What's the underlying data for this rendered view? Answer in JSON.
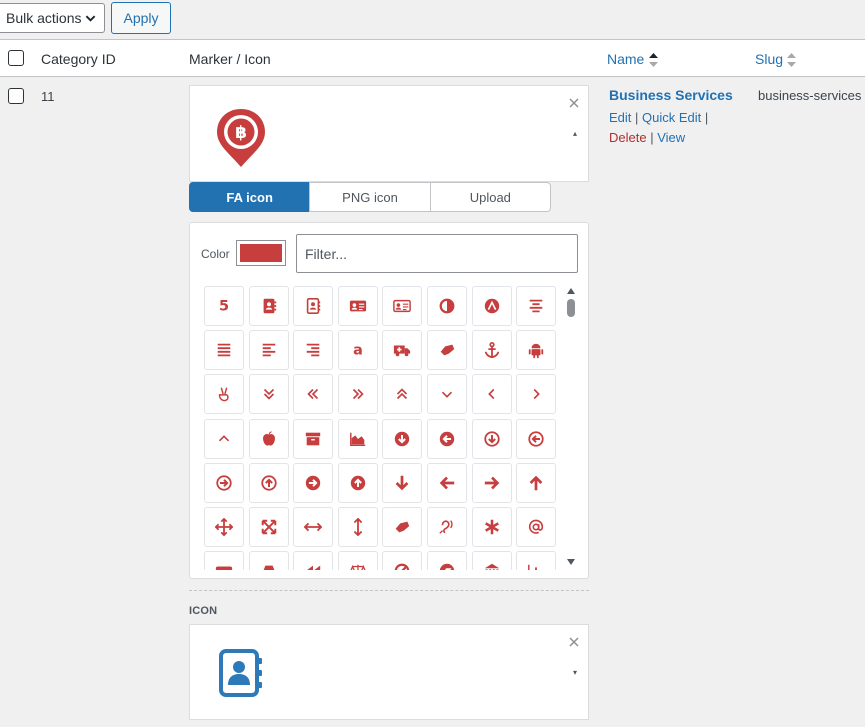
{
  "toolbar": {
    "bulk_actions_label": "Bulk actions",
    "apply_label": "Apply"
  },
  "table": {
    "columns": {
      "category_id": "Category ID",
      "marker_icon": "Marker / Icon",
      "name": "Name",
      "slug": "Slug"
    },
    "row": {
      "id": "11",
      "name": "Business Services",
      "slug": "business-services",
      "actions": {
        "edit": "Edit",
        "quick_edit": "Quick Edit",
        "delete": "Delete",
        "view": "View",
        "separator": "|"
      }
    }
  },
  "marker_editor": {
    "preview": {
      "icon": "bitcoin-map-marker-icon",
      "color": "#c73e3e"
    },
    "tabs": [
      {
        "label": "FA icon",
        "active": true
      },
      {
        "label": "PNG icon",
        "active": false
      },
      {
        "label": "Upload",
        "active": false
      }
    ],
    "picker": {
      "color_label": "Color",
      "color_value": "#c73e3e",
      "filter_placeholder": "Filter...",
      "icons": [
        "500px-icon",
        "address-book-icon",
        "address-book-o-icon",
        "address-card-icon",
        "address-card-o-icon",
        "adjust-icon",
        "adn-icon",
        "align-center-icon",
        "align-justify-icon",
        "align-left-icon",
        "align-right-icon",
        "amazon-icon",
        "ambulance-icon",
        "american-sign-language-icon",
        "anchor-icon",
        "android-icon",
        "angellist-icon",
        "angle-double-down-icon",
        "angle-double-left-icon",
        "angle-double-right-icon",
        "angle-double-up-icon",
        "angle-down-icon",
        "angle-left-icon",
        "angle-right-icon",
        "angle-up-icon",
        "apple-icon",
        "archive-icon",
        "area-chart-icon",
        "arrow-circle-down-icon",
        "arrow-circle-left-icon",
        "arrow-circle-o-down-icon",
        "arrow-circle-o-left-icon",
        "arrow-circle-o-right-icon",
        "arrow-circle-o-up-icon",
        "arrow-circle-right-icon",
        "arrow-circle-up-icon",
        "arrow-down-icon",
        "arrow-left-icon",
        "arrow-right-icon",
        "arrow-up-icon",
        "arrows-icon",
        "arrows-alt-icon",
        "arrows-h-icon",
        "arrows-v-icon",
        "asl-interpreting-icon",
        "assistive-listening-icon",
        "asterisk-icon",
        "at-icon",
        "audio-description-icon",
        "automobile-icon",
        "backward-icon",
        "balance-scale-icon",
        "ban-icon",
        "bandcamp-icon",
        "bank-icon",
        "bar-chart-icon"
      ]
    }
  },
  "icon_section": {
    "label": "ICON",
    "preview": {
      "icon": "address-book-icon",
      "color": "#2e7ab8"
    }
  }
}
